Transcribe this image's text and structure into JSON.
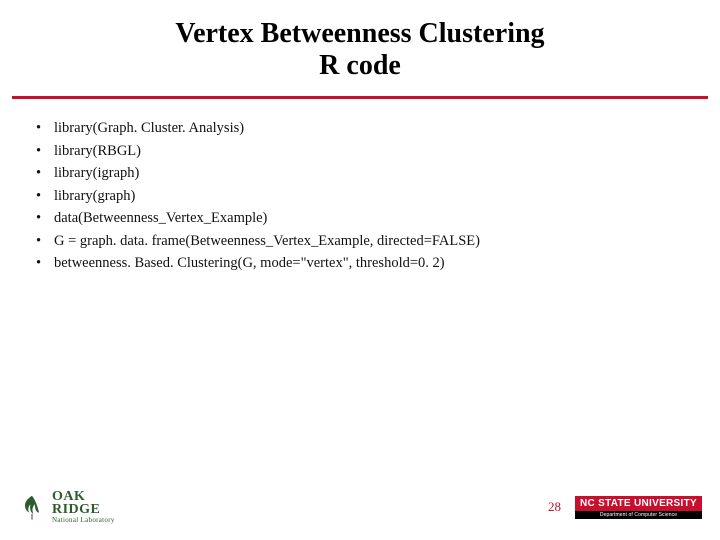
{
  "title": {
    "line1": "Vertex Betweenness Clustering",
    "line2": "R code"
  },
  "bullets": [
    "library(Graph. Cluster. Analysis)",
    "library(RBGL)",
    "library(igraph)",
    "library(graph)",
    "data(Betweenness_Vertex_Example)",
    "G = graph. data. frame(Betweenness_Vertex_Example, directed=FALSE)",
    "betweenness. Based. Clustering(G, mode=\"vertex\", threshold=0. 2)"
  ],
  "footer": {
    "oak_top": "OAK",
    "oak_bottom": "RIDGE",
    "oak_sub": "National Laboratory",
    "page_number": "28",
    "ncstate_top": "NC STATE UNIVERSITY",
    "ncstate_bottom": "Department of Computer Science"
  }
}
